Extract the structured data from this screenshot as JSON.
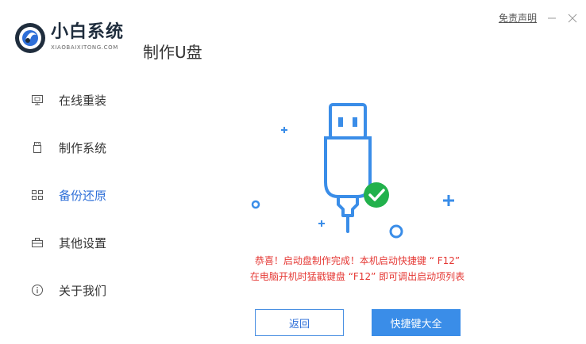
{
  "app": {
    "brand_name": "小白系统",
    "brand_sub": "XIAOBAIXITONG.COM",
    "page_title": "制作U盘"
  },
  "window": {
    "disclaimer": "免责声明",
    "minimize_icon": "minimize-icon",
    "close_icon": "close-icon"
  },
  "sidebar": {
    "items": [
      {
        "label": "在线重装",
        "icon": "monitor-icon",
        "active": false
      },
      {
        "label": "制作系统",
        "icon": "usb-drive-icon",
        "active": false
      },
      {
        "label": "备份还原",
        "icon": "grid-icon",
        "active": true
      },
      {
        "label": "其他设置",
        "icon": "toolbox-icon",
        "active": false
      },
      {
        "label": "关于我们",
        "icon": "info-icon",
        "active": false
      }
    ]
  },
  "main": {
    "message_line1": "恭喜！启动盘制作完成！本机启动快捷键 “ F12”",
    "message_line2": "在电脑开机时猛戳键盘 “F12” 即可调出启动项列表",
    "back_button": "返回",
    "hotkeys_button": "快捷键大全"
  },
  "colors": {
    "accent": "#2e6fd8",
    "primary_button": "#3a8de8",
    "message": "#e53935",
    "success": "#22b14c"
  }
}
